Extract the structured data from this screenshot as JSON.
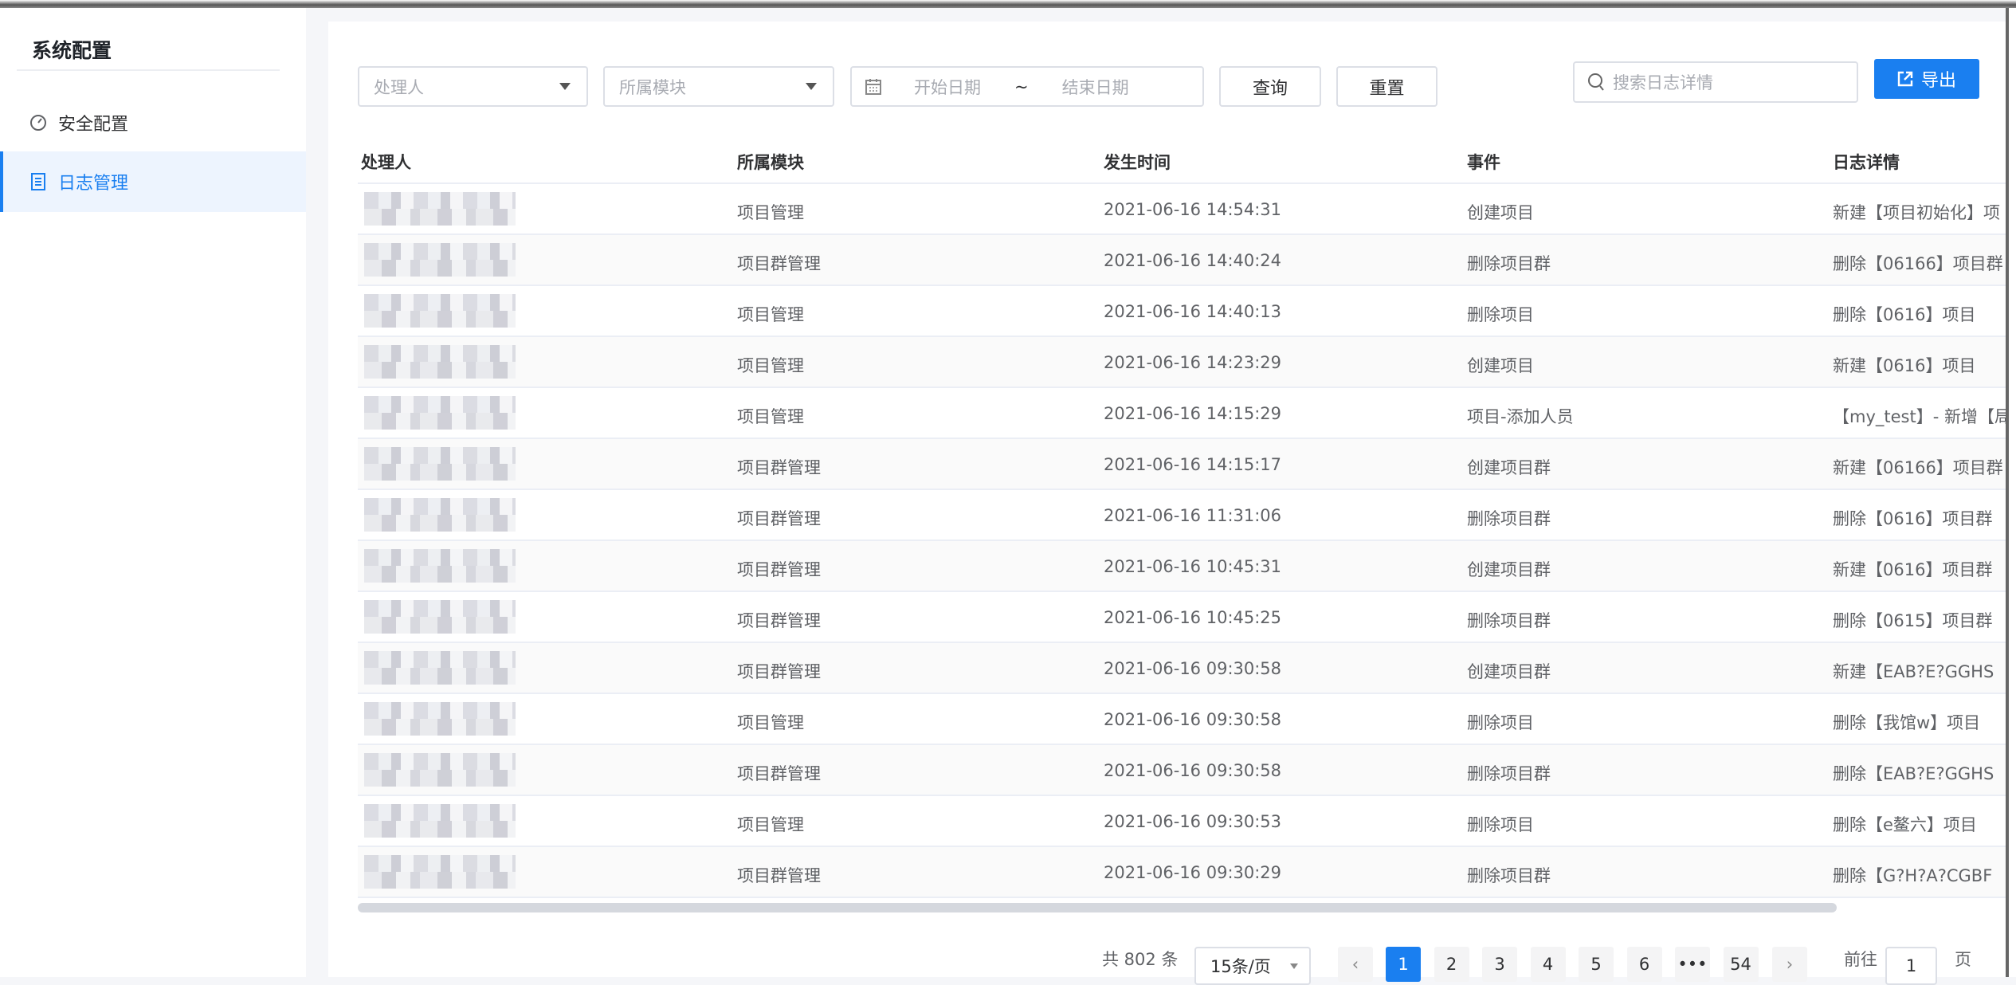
{
  "sidebar": {
    "title": "系统配置",
    "items": [
      {
        "label": "安全配置",
        "icon": "gauge-icon"
      },
      {
        "label": "日志管理",
        "icon": "document-list-icon",
        "active": true
      }
    ]
  },
  "filters": {
    "handler_placeholder": "处理人",
    "module_placeholder": "所属模块",
    "start_placeholder": "开始日期",
    "separator": "~",
    "end_placeholder": "结束日期",
    "query_label": "查询",
    "reset_label": "重置",
    "search_placeholder": "搜索日志详情",
    "export_label": "导出"
  },
  "table": {
    "columns": [
      "处理人",
      "所属模块",
      "发生时间",
      "事件",
      "日志详情"
    ],
    "rows": [
      {
        "module": "项目管理",
        "time": "2021-06-16 14:54:31",
        "event": "创建项目",
        "detail": "新建【项目初始化】项"
      },
      {
        "module": "项目群管理",
        "time": "2021-06-16 14:40:24",
        "event": "删除项目群",
        "detail": "删除【06166】项目群"
      },
      {
        "module": "项目管理",
        "time": "2021-06-16 14:40:13",
        "event": "删除项目",
        "detail": "删除【0616】项目"
      },
      {
        "module": "项目管理",
        "time": "2021-06-16 14:23:29",
        "event": "创建项目",
        "detail": "新建【0616】项目"
      },
      {
        "module": "项目管理",
        "time": "2021-06-16 14:15:29",
        "event": "项目-添加人员",
        "detail": "【my_test】- 新增【局"
      },
      {
        "module": "项目群管理",
        "time": "2021-06-16 14:15:17",
        "event": "创建项目群",
        "detail": "新建【06166】项目群"
      },
      {
        "module": "项目群管理",
        "time": "2021-06-16 11:31:06",
        "event": "删除项目群",
        "detail": "删除【0616】项目群"
      },
      {
        "module": "项目群管理",
        "time": "2021-06-16 10:45:31",
        "event": "创建项目群",
        "detail": "新建【0616】项目群"
      },
      {
        "module": "项目群管理",
        "time": "2021-06-16 10:45:25",
        "event": "删除项目群",
        "detail": "删除【0615】项目群"
      },
      {
        "module": "项目群管理",
        "time": "2021-06-16 09:30:58",
        "event": "创建项目群",
        "detail": "新建【EAB?E?GGHS"
      },
      {
        "module": "项目管理",
        "time": "2021-06-16 09:30:58",
        "event": "删除项目",
        "detail": "删除【我馆w】项目"
      },
      {
        "module": "项目群管理",
        "time": "2021-06-16 09:30:58",
        "event": "删除项目群",
        "detail": "删除【EAB?E?GGHS"
      },
      {
        "module": "项目管理",
        "time": "2021-06-16 09:30:53",
        "event": "删除项目",
        "detail": "删除【e鳌六】项目"
      },
      {
        "module": "项目群管理",
        "time": "2021-06-16 09:30:29",
        "event": "删除项目群",
        "detail": "删除【G?H?A?CGBF"
      }
    ]
  },
  "pagination": {
    "total_label": "共 802 条",
    "page_size": "15条/页",
    "pages": [
      "1",
      "2",
      "3",
      "4",
      "5",
      "6",
      "•••",
      "54"
    ],
    "current": "1",
    "goto_label": "前往",
    "goto_value": "1",
    "page_suffix": "页",
    "prev": "‹",
    "next": "›"
  },
  "colors": {
    "accent": "#1a7ff0"
  }
}
